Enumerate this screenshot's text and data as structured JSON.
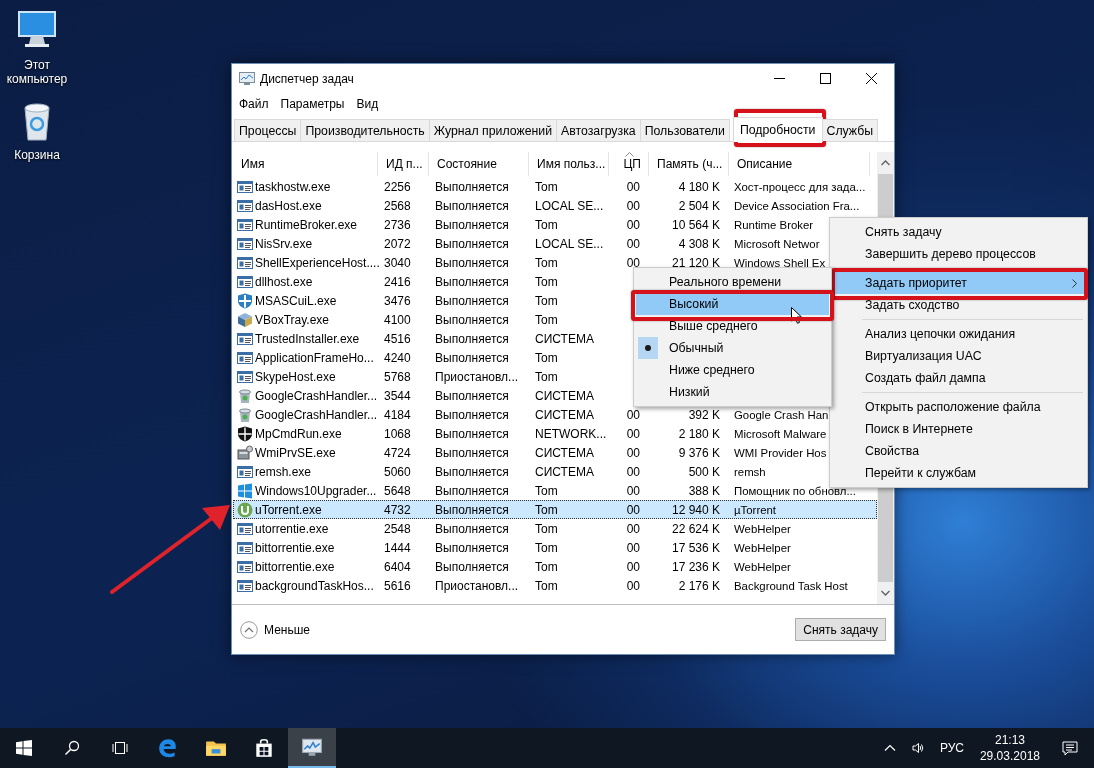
{
  "desktop_icons": [
    {
      "kind": "computer",
      "label": "Этот компьютер"
    },
    {
      "kind": "recycle",
      "label": "Корзина"
    }
  ],
  "window": {
    "title": "Диспетчер задач",
    "menu": [
      "Файл",
      "Параметры",
      "Вид"
    ],
    "tabs": [
      {
        "label": "Процессы",
        "selected": false
      },
      {
        "label": "Производительность",
        "selected": false
      },
      {
        "label": "Журнал приложений",
        "selected": false
      },
      {
        "label": "Автозагрузка",
        "selected": false
      },
      {
        "label": "Пользователи",
        "selected": false
      },
      {
        "label": "Подробности",
        "selected": true,
        "annotated": true
      },
      {
        "label": "Службы",
        "selected": false
      }
    ],
    "table": {
      "columns": [
        {
          "label": "Имя",
          "sorted": false
        },
        {
          "label": "ИД п...",
          "sorted": false
        },
        {
          "label": "Состояние",
          "sorted": false
        },
        {
          "label": "Имя польз...",
          "sorted": false
        },
        {
          "label": "ЦП",
          "sorted": true
        },
        {
          "label": "Память (ч...",
          "sorted": false
        },
        {
          "label": "Описание",
          "sorted": false
        }
      ],
      "rows": [
        {
          "kind": "generic",
          "name": "taskhostw.exe",
          "pid": "2256",
          "status": "Выполняется",
          "user": "Tom",
          "cpu": "00",
          "memory": "4 180 K",
          "description": "Хост-процесс для зада...",
          "selected": false
        },
        {
          "kind": "generic",
          "name": "dasHost.exe",
          "pid": "2568",
          "status": "Выполняется",
          "user": "LOCAL SE...",
          "cpu": "00",
          "memory": "2 504 K",
          "description": "Device Association Fra...",
          "selected": false
        },
        {
          "kind": "generic",
          "name": "RuntimeBroker.exe",
          "pid": "2736",
          "status": "Выполняется",
          "user": "Tom",
          "cpu": "00",
          "memory": "10 564 K",
          "description": "Runtime Broker",
          "selected": false
        },
        {
          "kind": "generic",
          "name": "NisSrv.exe",
          "pid": "2072",
          "status": "Выполняется",
          "user": "LOCAL SE...",
          "cpu": "00",
          "memory": "4 308 K",
          "description": "Microsoft Networ",
          "selected": false
        },
        {
          "kind": "generic",
          "name": "ShellExperienceHost....",
          "pid": "3040",
          "status": "Выполняется",
          "user": "Tom",
          "cpu": "00",
          "memory": "21 120 K",
          "description": "Windows Shell Ex",
          "selected": false
        },
        {
          "kind": "generic",
          "name": "dllhost.exe",
          "pid": "2416",
          "status": "Выполняется",
          "user": "Tom",
          "selected": false
        },
        {
          "kind": "shield",
          "name": "MSASCuiL.exe",
          "pid": "3476",
          "status": "Выполняется",
          "user": "Tom",
          "selected": false
        },
        {
          "kind": "cube",
          "name": "VBoxTray.exe",
          "pid": "4100",
          "status": "Выполняется",
          "user": "Tom",
          "selected": false
        },
        {
          "kind": "generic",
          "name": "TrustedInstaller.exe",
          "pid": "4516",
          "status": "Выполняется",
          "user": "СИСТЕМА",
          "selected": false
        },
        {
          "kind": "generic",
          "name": "ApplicationFrameHo...",
          "pid": "4240",
          "status": "Выполняется",
          "user": "Tom",
          "selected": false
        },
        {
          "kind": "generic",
          "name": "SkypeHost.exe",
          "pid": "5768",
          "status": "Приостановл...",
          "user": "Tom",
          "selected": false
        },
        {
          "kind": "bin",
          "name": "GoogleCrashHandler...",
          "pid": "3544",
          "status": "Выполняется",
          "user": "СИСТЕМА",
          "selected": false
        },
        {
          "kind": "bin",
          "name": "GoogleCrashHandler...",
          "pid": "4184",
          "status": "Выполняется",
          "user": "СИСТЕМА",
          "cpu": "00",
          "memory": "392 K",
          "description": "Google Crash Han",
          "selected": false
        },
        {
          "kind": "dark-shield",
          "name": "MpCmdRun.exe",
          "pid": "1068",
          "status": "Выполняется",
          "user": "NETWORK...",
          "cpu": "00",
          "memory": "2 180 K",
          "description": "Microsoft Malware",
          "selected": false
        },
        {
          "kind": "server",
          "name": "WmiPrvSE.exe",
          "pid": "4724",
          "status": "Выполняется",
          "user": "СИСТЕМА",
          "cpu": "00",
          "memory": "9 376 K",
          "description": "WMI Provider Hos",
          "selected": false
        },
        {
          "kind": "generic",
          "name": "remsh.exe",
          "pid": "5060",
          "status": "Выполняется",
          "user": "СИСТЕМА",
          "cpu": "00",
          "memory": "500 K",
          "description": "remsh",
          "selected": false
        },
        {
          "kind": "windows",
          "name": "Windows10Upgrader...",
          "pid": "5648",
          "status": "Выполняется",
          "user": "Tom",
          "cpu": "00",
          "memory": "388 K",
          "description": "Помощник по обновл...",
          "selected": false
        },
        {
          "kind": "torrent",
          "name": "uTorrent.exe",
          "pid": "4732",
          "status": "Выполняется",
          "user": "Tom",
          "cpu": "00",
          "memory": "12 940 K",
          "description": "µTorrent",
          "selected": true,
          "annotated": true
        },
        {
          "kind": "generic",
          "name": "utorrentie.exe",
          "pid": "2548",
          "status": "Выполняется",
          "user": "Tom",
          "cpu": "00",
          "memory": "22 624 K",
          "description": "WebHelper",
          "selected": false
        },
        {
          "kind": "generic",
          "name": "bittorrentie.exe",
          "pid": "1444",
          "status": "Выполняется",
          "user": "Tom",
          "cpu": "00",
          "memory": "17 536 K",
          "description": "WebHelper",
          "selected": false
        },
        {
          "kind": "generic",
          "name": "bittorrentie.exe",
          "pid": "6404",
          "status": "Выполняется",
          "user": "Tom",
          "cpu": "00",
          "memory": "17 236 K",
          "description": "WebHelper",
          "selected": false
        },
        {
          "kind": "generic",
          "name": "backgroundTaskHos...",
          "pid": "5616",
          "status": "Приостановл...",
          "user": "Tom",
          "cpu": "00",
          "memory": "2 176 K",
          "description": "Background Task Host",
          "selected": false
        }
      ]
    },
    "less_label": "Меньше",
    "end_task_button": "Снять задачу"
  },
  "context_menu": {
    "groups": [
      [
        {
          "label": "Снять задачу",
          "highlighted": false
        },
        {
          "label": "Завершить дерево процессов",
          "highlighted": false
        }
      ],
      [
        {
          "label": "Задать приоритет",
          "highlighted": true,
          "submenu": true,
          "annotated": true
        },
        {
          "label": "Задать сходство",
          "highlighted": false
        }
      ],
      [
        {
          "label": "Анализ цепочки ожидания",
          "highlighted": false
        },
        {
          "label": "Виртуализация UAC",
          "highlighted": false
        },
        {
          "label": "Создать файл дампа",
          "highlighted": false
        }
      ],
      [
        {
          "label": "Открыть расположение файла",
          "highlighted": false
        },
        {
          "label": "Поиск в Интернете",
          "highlighted": false
        },
        {
          "label": "Свойства",
          "highlighted": false
        },
        {
          "label": "Перейти к службам",
          "highlighted": false
        }
      ]
    ]
  },
  "priority_menu": {
    "items": [
      {
        "label": "Реального времени",
        "checked": false,
        "highlighted": false
      },
      {
        "label": "Высокий",
        "checked": false,
        "highlighted": true,
        "annotated": true
      },
      {
        "label": "Выше среднего",
        "checked": false,
        "highlighted": false
      },
      {
        "label": "Обычный",
        "checked": true,
        "highlighted": false
      },
      {
        "label": "Ниже среднего",
        "checked": false,
        "highlighted": false
      },
      {
        "label": "Низкий",
        "checked": false,
        "highlighted": false
      }
    ]
  },
  "taskbar": {
    "apps": [
      {
        "kind": "start",
        "active": false
      },
      {
        "kind": "search",
        "active": false
      },
      {
        "kind": "task-view",
        "active": false
      },
      {
        "kind": "browser",
        "active": false
      },
      {
        "kind": "folder",
        "active": false
      },
      {
        "kind": "store",
        "active": false
      },
      {
        "kind": "monitor",
        "active": true
      }
    ],
    "language": "РУС",
    "time": "21:13",
    "date": "29.03.2018"
  }
}
